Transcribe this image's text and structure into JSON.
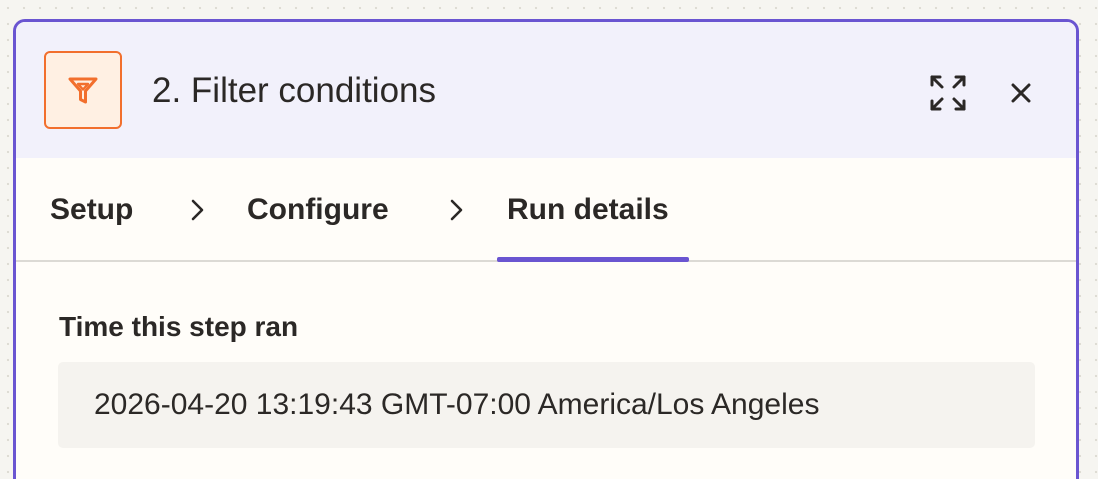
{
  "panel": {
    "title": "2. Filter conditions",
    "app_icon": "filter-icon",
    "actions": {
      "expand_icon": "expand-icon",
      "close_icon": "close-icon"
    }
  },
  "tabs": [
    {
      "label": "Setup",
      "active": false
    },
    {
      "label": "Configure",
      "active": false
    },
    {
      "label": "Run details",
      "active": true
    }
  ],
  "run_details": {
    "time_label": "Time this step ran",
    "time_value": "2026-04-20 13:19:43 GMT-07:00 America/Los Angeles"
  },
  "colors": {
    "accent": "#6a55d1",
    "brand_orange": "#f26f2d",
    "header_bg": "#f2f1fb"
  }
}
